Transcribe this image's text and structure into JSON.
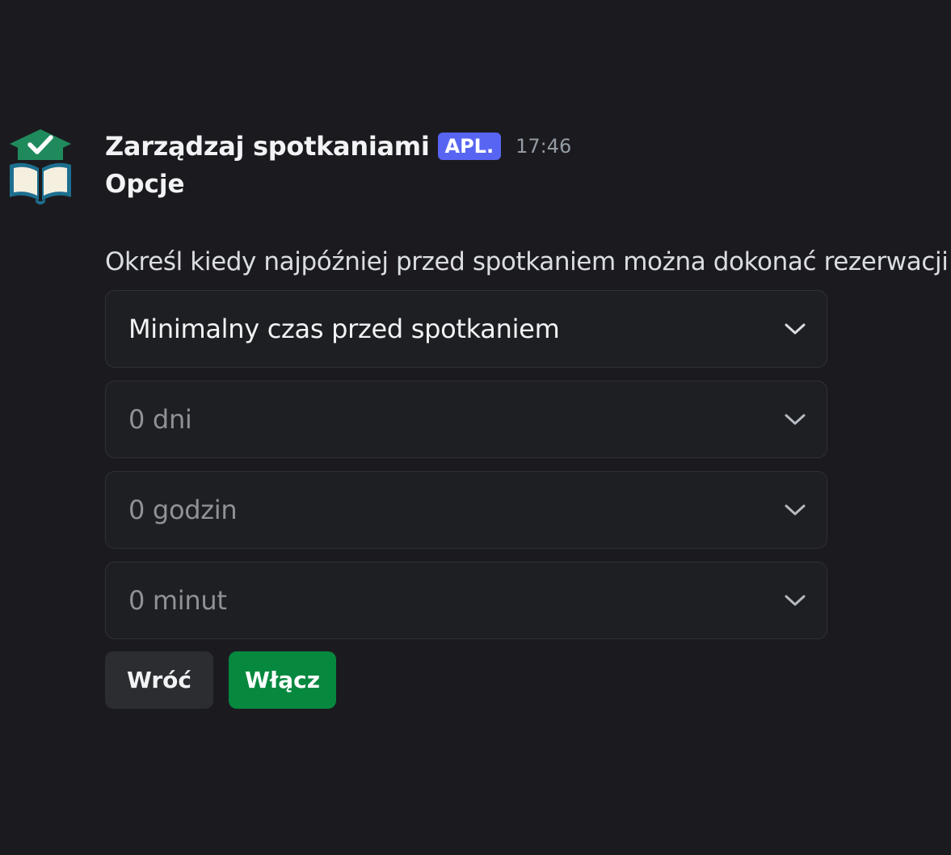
{
  "message": {
    "author": "Zarządzaj spotkaniami",
    "badge": "APL.",
    "time": "17:46",
    "title": "Opcje",
    "description": "Określ kiedy najpóźniej przed spotkaniem można dokonać rezerwacji",
    "avatar_icon": "book-graduation-cap-check-icon"
  },
  "selects": [
    {
      "label": "Minimalny czas przed spotkaniem",
      "state": "selected",
      "icon": "chevron-down-icon"
    },
    {
      "label": "0 dni",
      "state": "placeholder",
      "icon": "chevron-down-icon"
    },
    {
      "label": "0 godzin",
      "state": "placeholder",
      "icon": "chevron-down-icon"
    },
    {
      "label": "0 minut",
      "state": "placeholder",
      "icon": "chevron-down-icon"
    }
  ],
  "buttons": {
    "back": "Wróć",
    "enable": "Włącz"
  },
  "colors": {
    "background": "#1b1b1f",
    "badge": "#5865f2",
    "enable_button": "#06883f",
    "avatar_green": "#1f8a5c",
    "avatar_blue": "#1d6f8f"
  }
}
